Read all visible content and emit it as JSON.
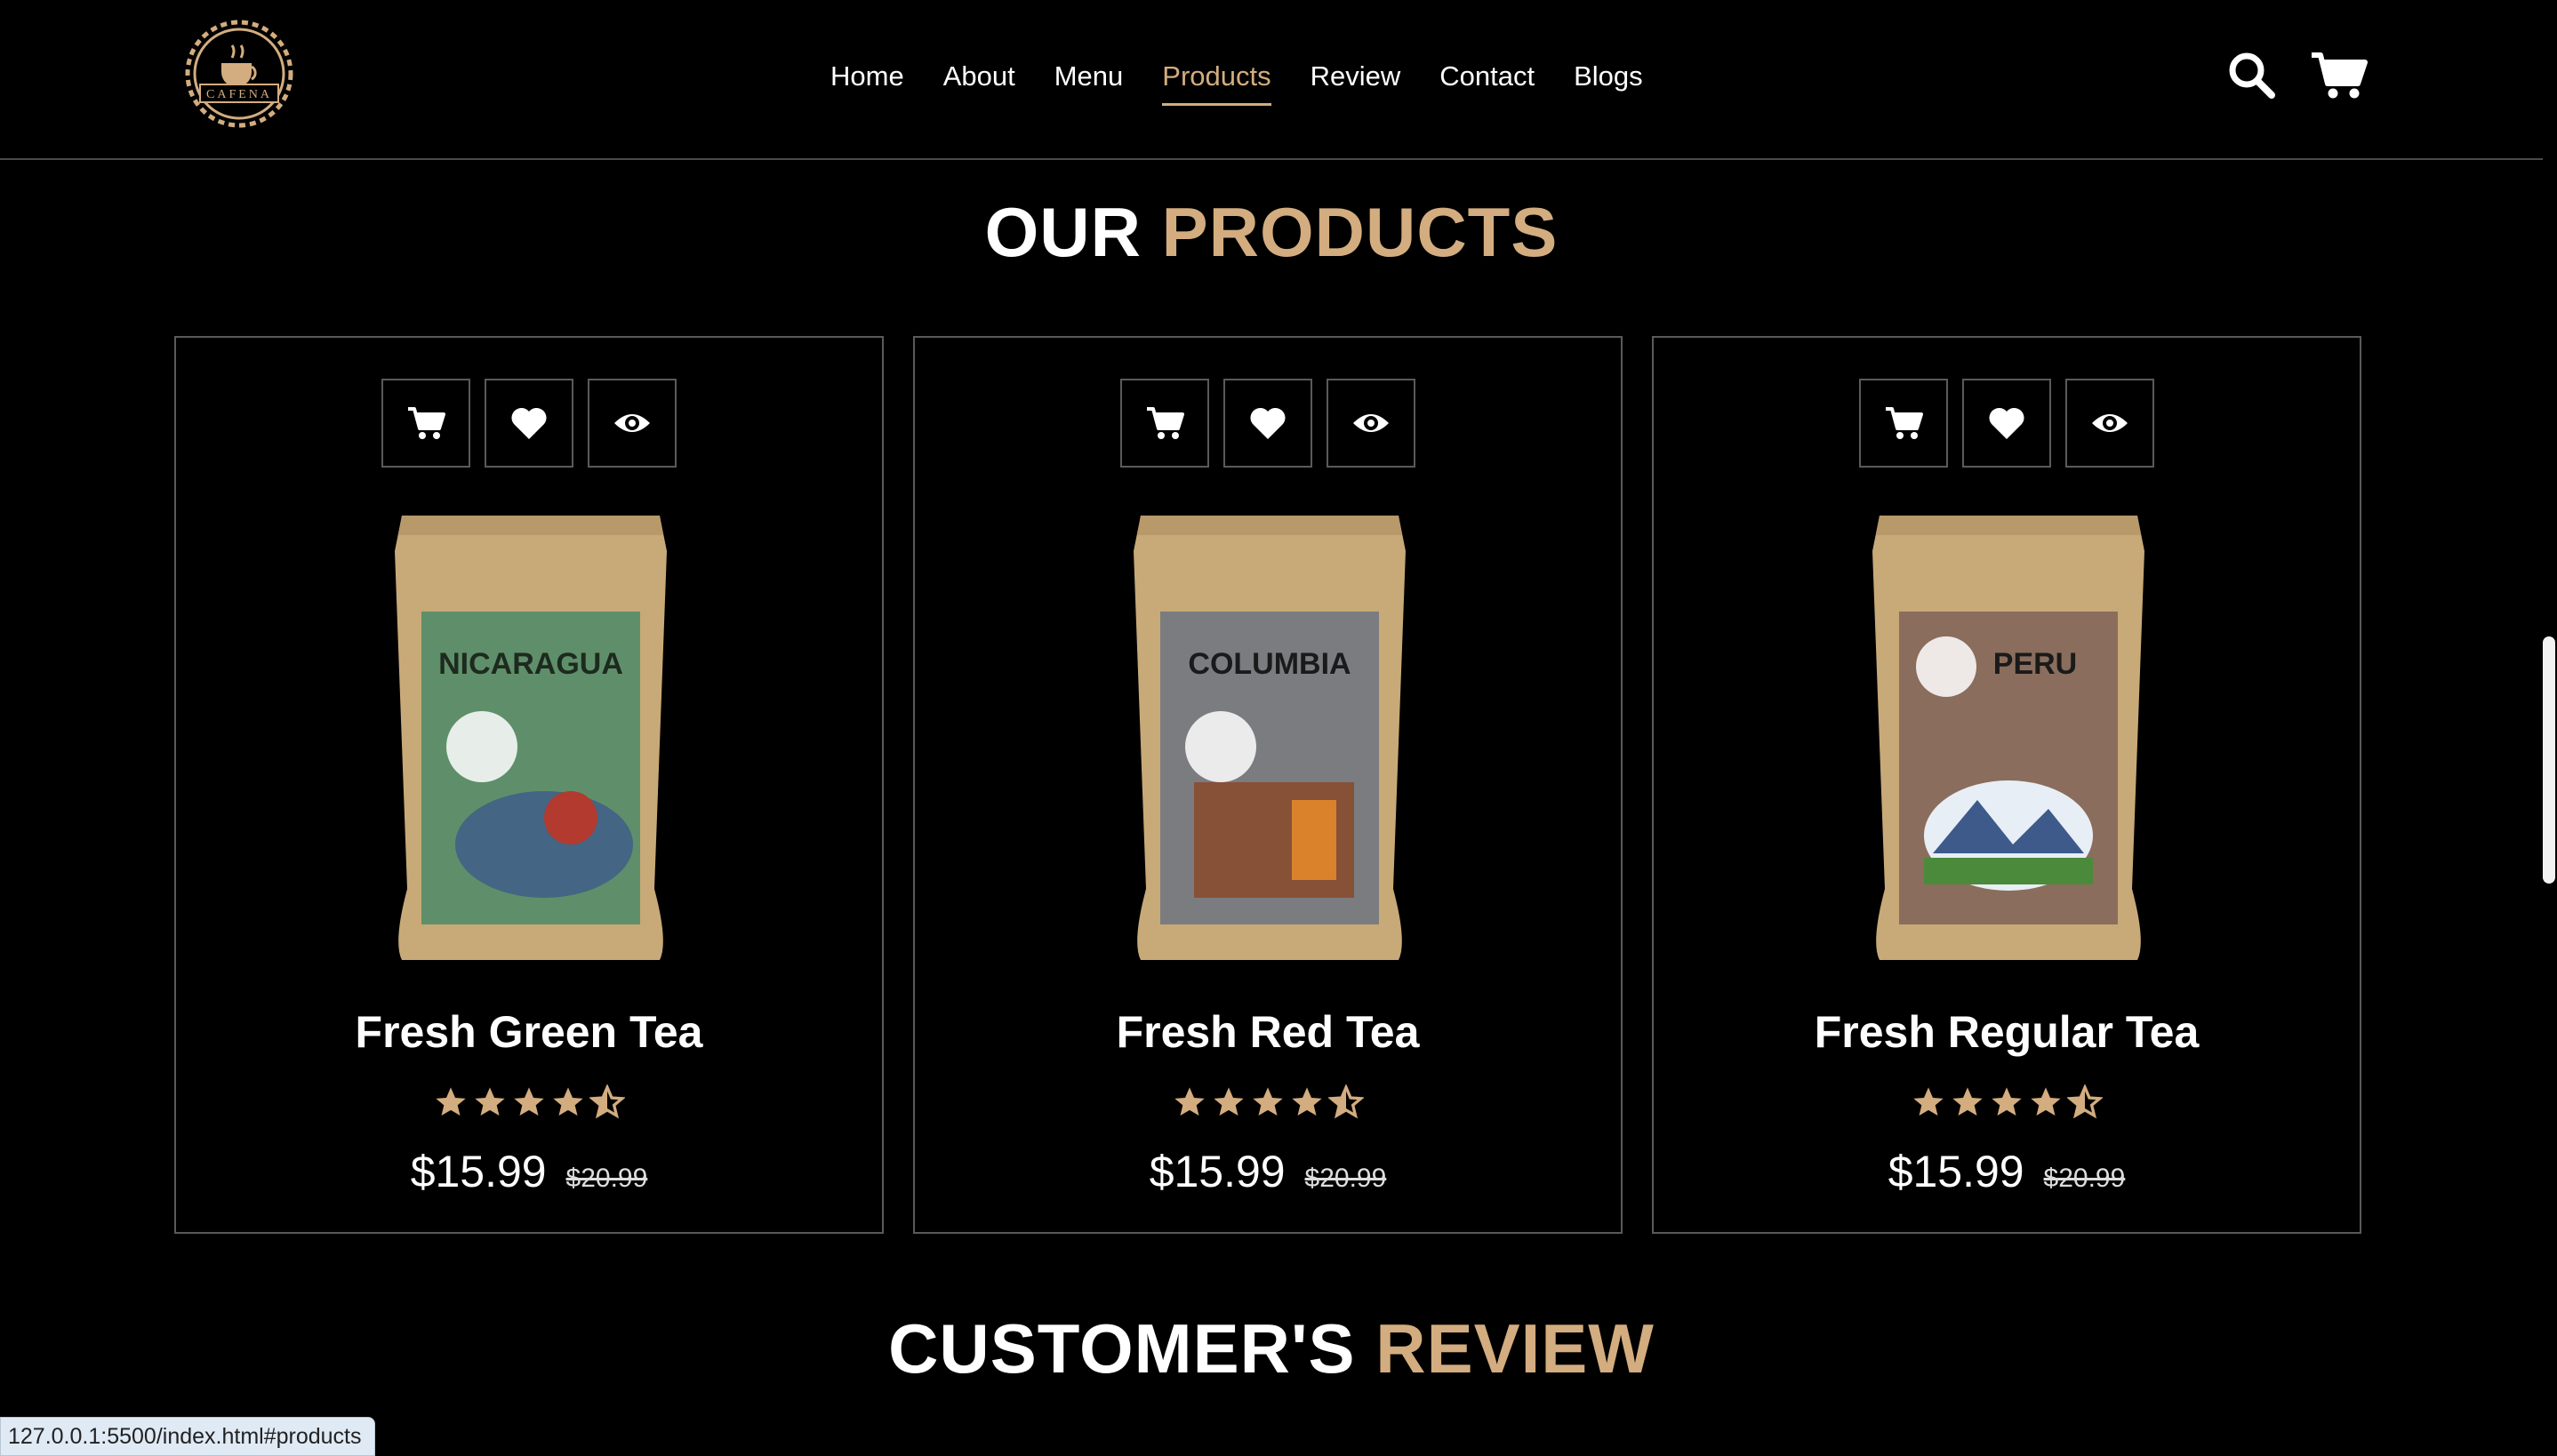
{
  "header": {
    "logo_text": "CAFENA",
    "nav": [
      {
        "label": "Home"
      },
      {
        "label": "About"
      },
      {
        "label": "Menu"
      },
      {
        "label": "Products",
        "active": true
      },
      {
        "label": "Review"
      },
      {
        "label": "Contact"
      },
      {
        "label": "Blogs"
      }
    ],
    "icons": [
      "search-icon",
      "cart-icon"
    ]
  },
  "products_heading": {
    "plain": "OUR",
    "accent": "PRODUCTS"
  },
  "products": [
    {
      "name": "Fresh Green Tea",
      "price": "$15.99",
      "old_price": "$20.99",
      "rating": 4.5,
      "bag_origin": "NICARAGUA",
      "bag_color": "#5f8f6a"
    },
    {
      "name": "Fresh Red Tea",
      "price": "$15.99",
      "old_price": "$20.99",
      "rating": 4.5,
      "bag_origin": "COLUMBIA",
      "bag_color": "#7a7c80"
    },
    {
      "name": "Fresh Regular Tea",
      "price": "$15.99",
      "old_price": "$20.99",
      "rating": 4.5,
      "bag_origin": "PERU",
      "bag_color": "#8a6d5c"
    }
  ],
  "card_actions": [
    "cart-icon",
    "heart-icon",
    "eye-icon"
  ],
  "review_heading": {
    "plain": "CUSTOMER'S",
    "accent": "REVIEW"
  },
  "status_url": "127.0.0.1:5500/index.html#products",
  "colors": {
    "accent": "#d3ad7f",
    "background": "#000000",
    "border": "#5a5a5a"
  }
}
